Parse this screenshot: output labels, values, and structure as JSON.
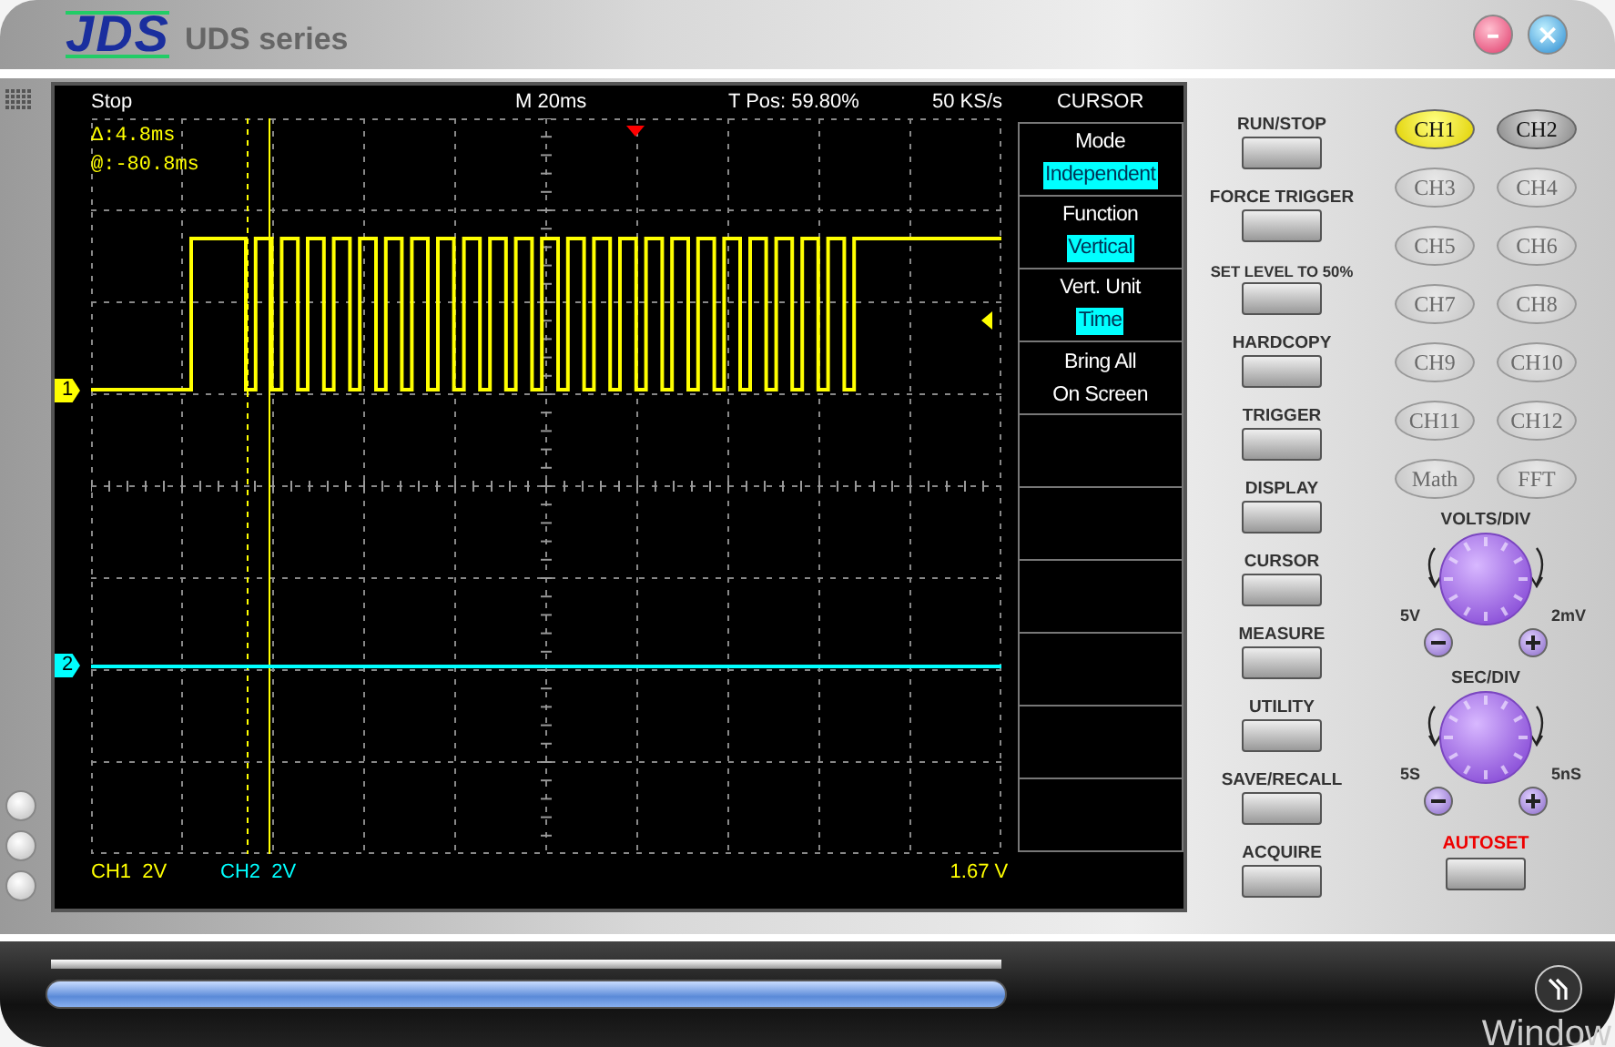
{
  "window": {
    "logo": "JDS",
    "title": "UDS series",
    "minimize": "–",
    "close": "×"
  },
  "scope": {
    "status": [
      "Stop",
      "M 20ms",
      "T Pos: 59.80%",
      "50 KS/s"
    ],
    "readouts": [
      "Δ:4.8ms",
      "@:-80.8ms"
    ],
    "channel_markers": [
      {
        "label": "1",
        "color": "#ffff00"
      },
      {
        "label": "2",
        "color": "#00ffff"
      }
    ],
    "scales": [
      {
        "text": "CH1  2V",
        "color": "#ffff00"
      },
      {
        "text": "CH2  2V",
        "color": "#00ffff"
      }
    ],
    "trigger_level": "1.67 V"
  },
  "menu": {
    "title": "CURSOR",
    "items": [
      {
        "kind": "option",
        "label": "Mode",
        "value": "Independent"
      },
      {
        "kind": "option",
        "label": "Function",
        "value": "Vertical"
      },
      {
        "kind": "option",
        "label": "Vert. Unit",
        "value": "Time"
      },
      {
        "kind": "action",
        "lines": [
          "Bring All",
          "On Screen"
        ]
      }
    ]
  },
  "controls": {
    "buttons": [
      "RUN/STOP",
      "FORCE TRIGGER",
      "SET LEVEL TO 50%",
      "HARDCOPY",
      "TRIGGER",
      "DISPLAY",
      "CURSOR",
      "MEASURE",
      "UTILITY",
      "SAVE/RECALL",
      "ACQUIRE"
    ],
    "channels": [
      {
        "label": "CH1",
        "selected": true,
        "disabled": false
      },
      {
        "label": "CH2",
        "selected": false,
        "disabled": false
      },
      {
        "label": "CH3",
        "selected": false,
        "disabled": true
      },
      {
        "label": "CH4",
        "selected": false,
        "disabled": true
      },
      {
        "label": "CH5",
        "selected": false,
        "disabled": true
      },
      {
        "label": "CH6",
        "selected": false,
        "disabled": true
      },
      {
        "label": "CH7",
        "selected": false,
        "disabled": true
      },
      {
        "label": "CH8",
        "selected": false,
        "disabled": true
      },
      {
        "label": "CH9",
        "selected": false,
        "disabled": true
      },
      {
        "label": "CH10",
        "selected": false,
        "disabled": true
      },
      {
        "label": "CH11",
        "selected": false,
        "disabled": true
      },
      {
        "label": "CH12",
        "selected": false,
        "disabled": true
      },
      {
        "label": "Math",
        "selected": false,
        "disabled": true
      },
      {
        "label": "FFT",
        "selected": false,
        "disabled": true
      }
    ],
    "knobs": [
      {
        "label": "VOLTS/DIV",
        "min": "5V",
        "max": "2mV"
      },
      {
        "label": "SEC/DIV",
        "min": "5S",
        "max": "5nS"
      }
    ],
    "autoset": "AUTOSET"
  },
  "footer": {
    "level": 1
  },
  "desktop_text": "Window"
}
